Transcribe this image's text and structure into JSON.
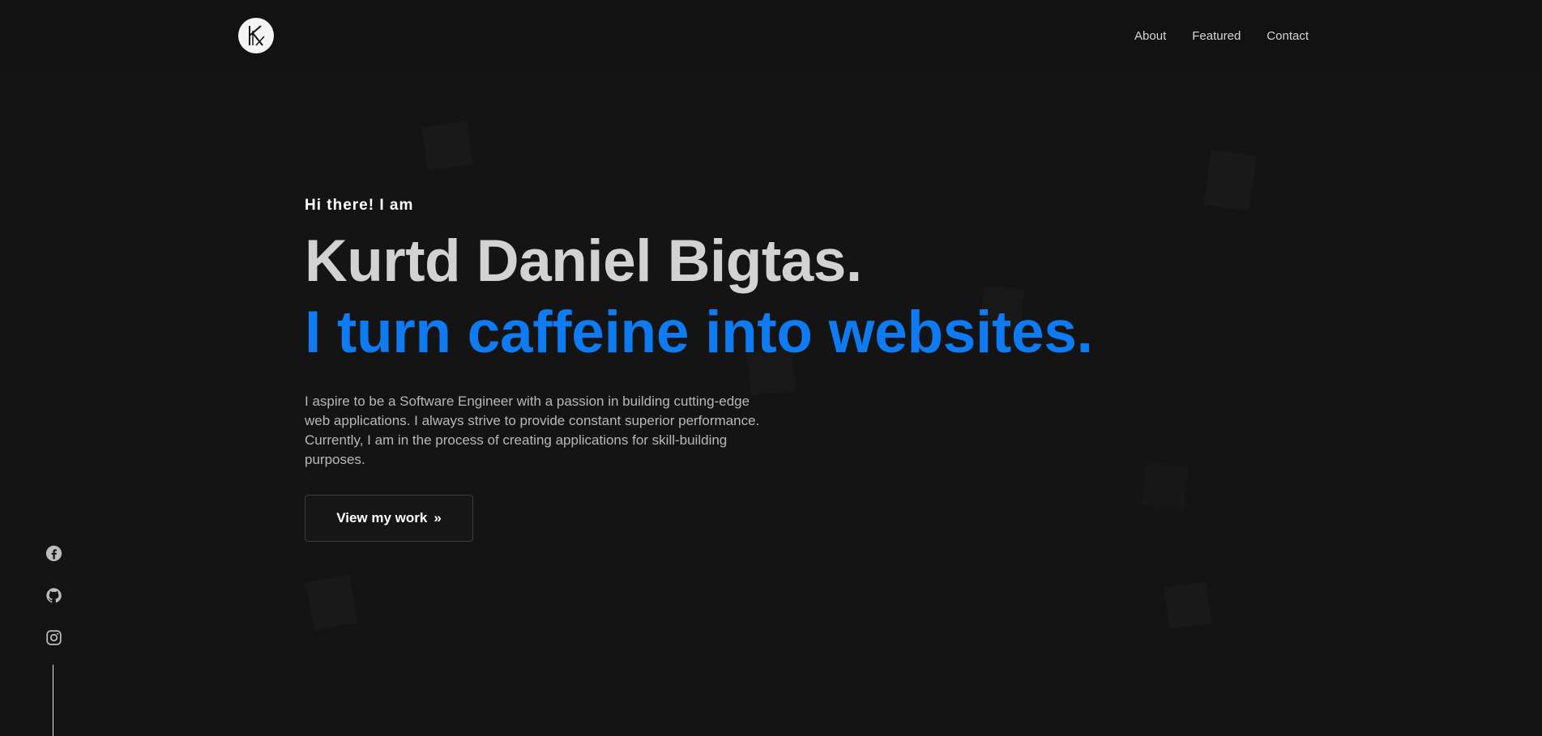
{
  "header": {
    "logo_alt": "K",
    "nav": [
      {
        "label": "About"
      },
      {
        "label": "Featured"
      },
      {
        "label": "Contact"
      }
    ]
  },
  "hero": {
    "intro": "Hi there! I am",
    "name": "Kurtd Daniel Bigtas.",
    "tagline": "I turn caffeine into websites.",
    "description": "I aspire to be a Software Engineer with a passion in building cutting-edge web applications. I always strive to provide constant superior performance. Currently, I am in the process of creating applications for skill-building purposes.",
    "cta_label": "View my work",
    "cta_icon": "»"
  },
  "socials": [
    {
      "icon": "facebook-icon"
    },
    {
      "icon": "github-icon"
    },
    {
      "icon": "instagram-icon"
    }
  ],
  "colors": {
    "background": "#141414",
    "accent": "#0f7bf2"
  }
}
